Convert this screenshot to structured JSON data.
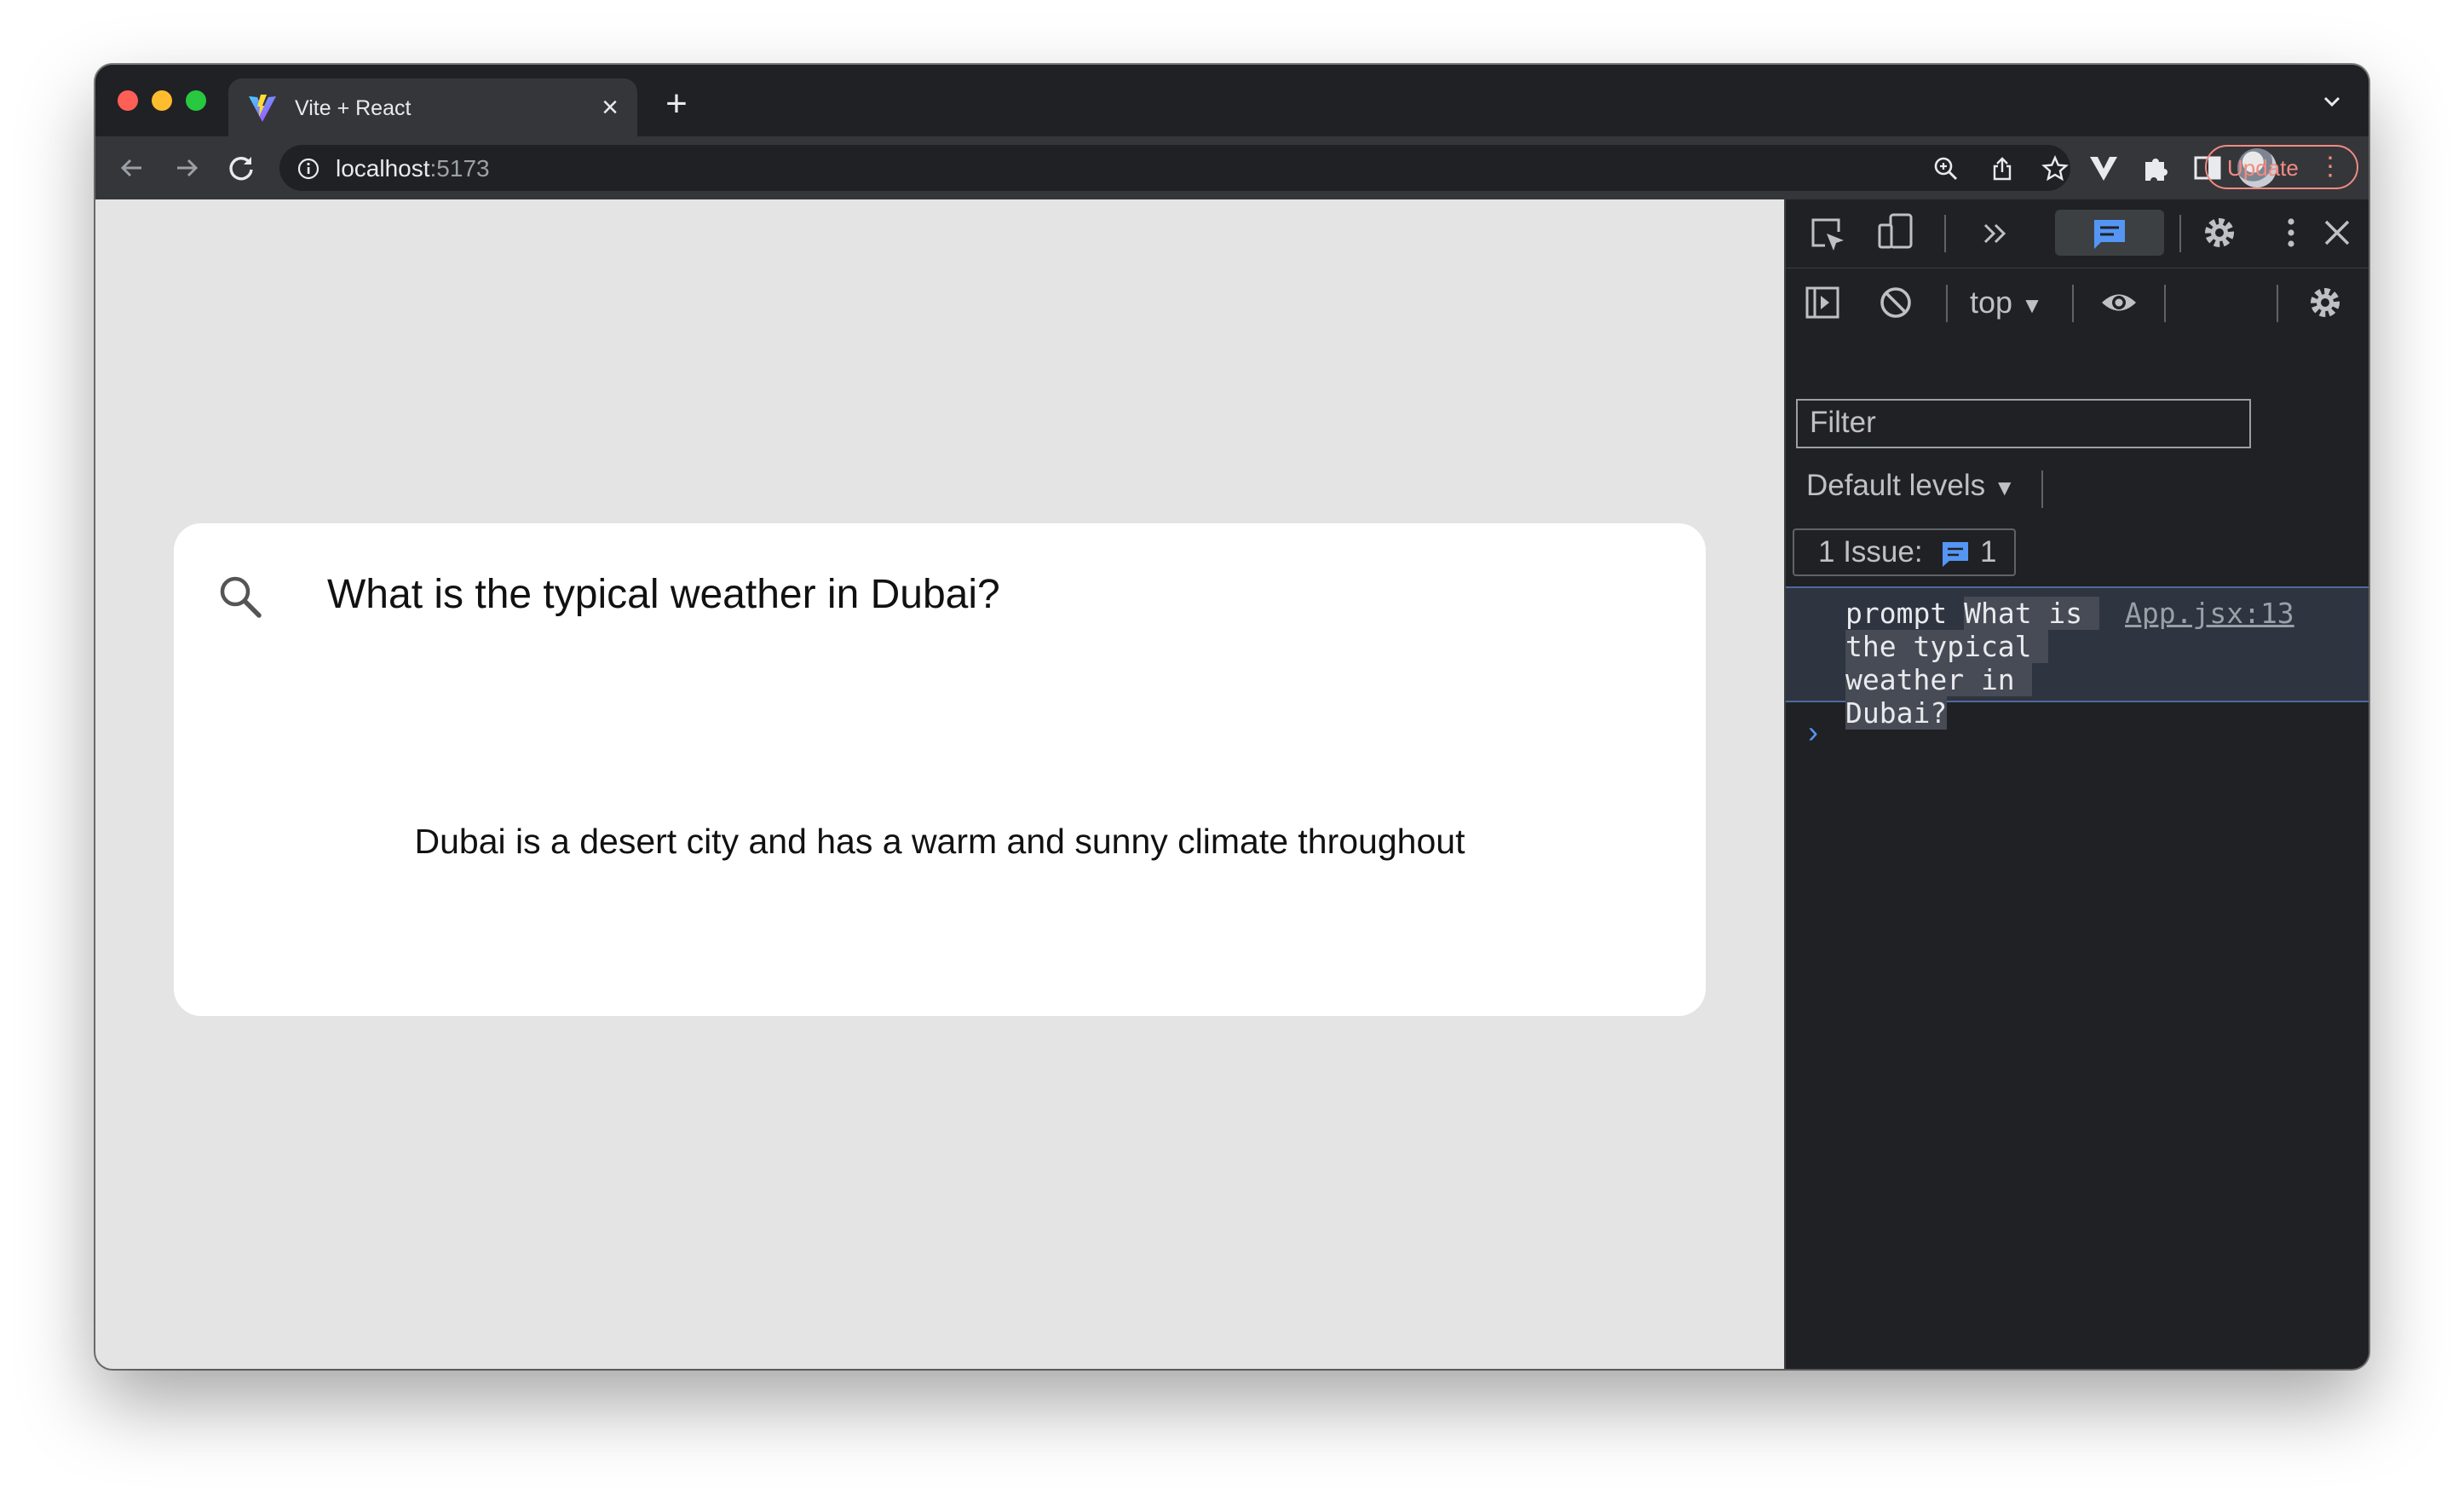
{
  "browser": {
    "tab": {
      "title": "Vite + React",
      "close": "×"
    },
    "new_tab": "+",
    "url": {
      "host": "localhost",
      "port": ":5173"
    },
    "update_label": "Update",
    "update_menu": "⋮"
  },
  "page": {
    "question": "What is the typical weather in Dubai?",
    "answer": "Dubai is a desert city and has a warm and sunny climate throughout"
  },
  "devtools": {
    "context": "top",
    "filter_placeholder": "Filter",
    "levels": "Default levels",
    "issues": {
      "label": "1 Issue:",
      "count": "1"
    },
    "log": {
      "label": "prompt",
      "value": "What is the typical weather in Dubai?",
      "source": "App.jsx:13"
    },
    "prompt_caret": "›"
  },
  "colors": {
    "accent_blue": "#5596f4",
    "update_red": "#f28b82",
    "page_bg": "#e4e4e4"
  }
}
